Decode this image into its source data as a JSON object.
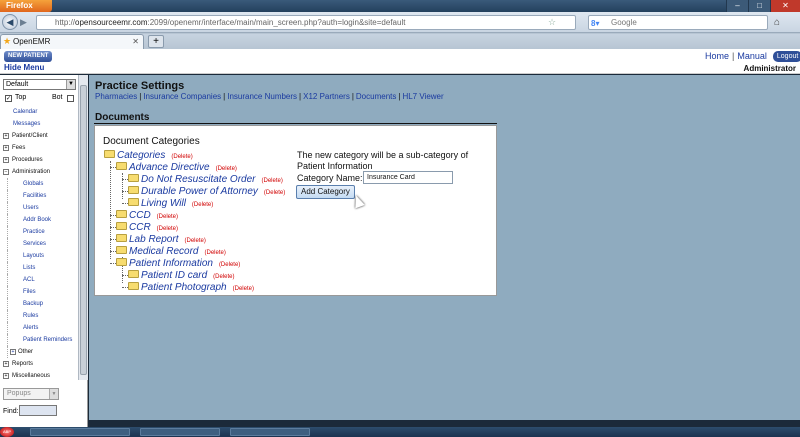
{
  "browser": {
    "menu_button": "Firefox",
    "url_prefix": "http://",
    "url_host": "opensourceemr.com",
    "url_rest": ":2099/openemr/interface/main/main_screen.php?auth=login&site=default",
    "search_placeholder": "Google",
    "tab_title": "OpenEMR",
    "new_tab": "+"
  },
  "header": {
    "new_patient": "NEW PATIENT",
    "hide_menu": "Hide Menu",
    "home": "Home",
    "manual": "Manual",
    "logout": "Logout",
    "username": "Administrator"
  },
  "leftnav": {
    "view_select": "Default",
    "top_label": "Top",
    "bot_label": "Bot",
    "top_checked": "✓",
    "items": {
      "calendar": "Calendar",
      "messages": "Messages",
      "patient_client": "Patient/Client",
      "fees": "Fees",
      "procedures": "Procedures",
      "administration": "Administration",
      "globals": "Globals",
      "facilities": "Facilities",
      "users": "Users",
      "addr_book": "Addr Book",
      "practice": "Practice",
      "services": "Services",
      "layouts": "Layouts",
      "lists": "Lists",
      "acl": "ACL",
      "files": "Files",
      "backup": "Backup",
      "rules": "Rules",
      "alerts": "Alerts",
      "patient_reminders": "Patient Reminders",
      "other": "Other",
      "reports": "Reports",
      "miscellaneous": "Miscellaneous"
    },
    "expand_plus": "+",
    "expand_minus": "−",
    "popups": "Popups",
    "find_label": "Find:"
  },
  "main": {
    "title": "Practice Settings",
    "links": [
      "Pharmacies",
      "Insurance Companies",
      "Insurance Numbers",
      "X12 Partners",
      "Documents",
      "HL7 Viewer"
    ],
    "link_sep": "|",
    "section_title": "Documents",
    "doc_categories_title": "Document Categories",
    "delete_label": "(Delete)",
    "tree": {
      "categories": "Categories",
      "advance_directive": "Advance Directive",
      "do_not_resuscitate": "Do Not Resuscitate Order",
      "durable_power": "Durable Power of Attorney",
      "living_will": "Living Will",
      "ccd": "CCD",
      "ccr": "CCR",
      "lab_report": "Lab Report",
      "medical_record": "Medical Record",
      "patient_information": "Patient Information",
      "patient_id_card": "Patient ID card",
      "patient_photograph": "Patient Photograph"
    },
    "new_category_msg": "The new category will be a sub-category of Patient Information",
    "category_name_label": "Category Name:",
    "category_name_value": "Insurance Card",
    "add_category": "Add Category"
  },
  "taskbar": {
    "start_label": "ABP"
  }
}
